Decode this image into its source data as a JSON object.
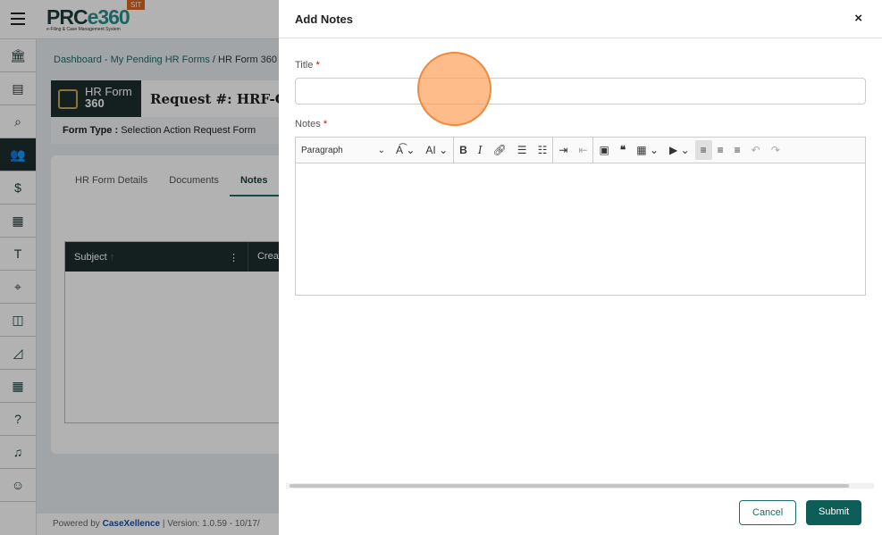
{
  "app": {
    "logo": "PRCe360",
    "logo_sub": "e-Filing & Case Management System",
    "env_badge": "SIT"
  },
  "breadcrumb": {
    "link": "Dashboard - My Pending HR Forms",
    "sep": " / ",
    "current": "HR Form 360"
  },
  "header": {
    "badge_line1": "HR Form",
    "badge_line2": "360",
    "request": "Request #: HRF-CNF-",
    "form_type_label": "Form Type :",
    "form_type": "Selection Action Request Form"
  },
  "tabs": [
    "HR Form Details",
    "Documents",
    "Notes"
  ],
  "grid": {
    "columns": [
      "Subject",
      "Create"
    ]
  },
  "footer": {
    "powered": "Powered by",
    "brand": "CaseXellence",
    "version": "|  Version: 1.0.59 - 10/17/"
  },
  "sidebar": [
    "bank",
    "document",
    "search-doc",
    "users",
    "invoice",
    "building",
    "note",
    "scan",
    "compare",
    "chart",
    "calendar",
    "help",
    "alarm",
    "profile"
  ],
  "dialog": {
    "title": "Add Notes",
    "close": "×",
    "title_label": "Title",
    "notes_label": "Notes",
    "required": "*",
    "title_value": "",
    "paragraph": "Paragraph",
    "cancel": "Cancel",
    "submit": "Submit"
  },
  "colors": {
    "primary": "#0d5e58",
    "dark": "#1d2e2e",
    "badge": "#d9661f"
  }
}
